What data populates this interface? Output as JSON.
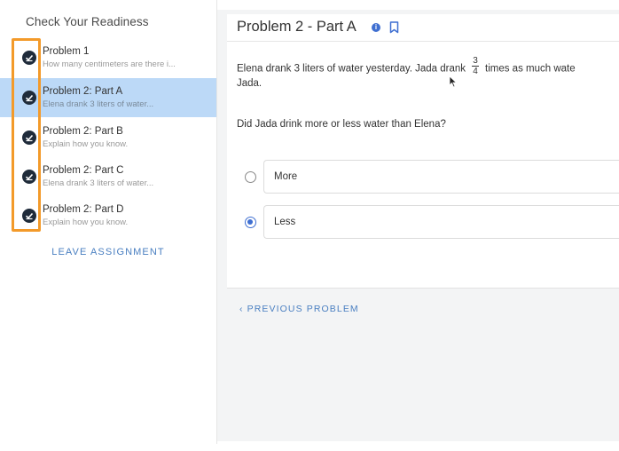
{
  "sidebar": {
    "title": "Check Your Readiness",
    "items": [
      {
        "title": "Problem 1",
        "subtitle": "How many centimeters are there i..."
      },
      {
        "title": "Problem 2: Part A",
        "subtitle": "Elena drank 3 liters of water..."
      },
      {
        "title": "Problem 2: Part B",
        "subtitle": "Explain how you know."
      },
      {
        "title": "Problem 2: Part C",
        "subtitle": "Elena drank 3 liters of water..."
      },
      {
        "title": "Problem 2: Part D",
        "subtitle": "Explain how you know."
      }
    ],
    "active_index": 1,
    "leave_label": "LEAVE ASSIGNMENT",
    "highlight_color": "#f39a2a"
  },
  "main": {
    "problem_title": "Problem 2 - Part A",
    "info_icon": "info-icon",
    "bookmark_icon": "bookmark-icon",
    "question_before": "Elena drank 3 liters of water yesterday. Jada drank",
    "fraction_num": "3",
    "fraction_den": "4",
    "question_after": "times as much wate",
    "question_cont": "Jada.",
    "prompt": "Did Jada drink more or less water than Elena?",
    "options": [
      {
        "label": "More",
        "selected": false
      },
      {
        "label": "Less",
        "selected": true
      }
    ],
    "prev_label": "PREVIOUS PROBLEM",
    "accent": "#3f6fd1"
  }
}
